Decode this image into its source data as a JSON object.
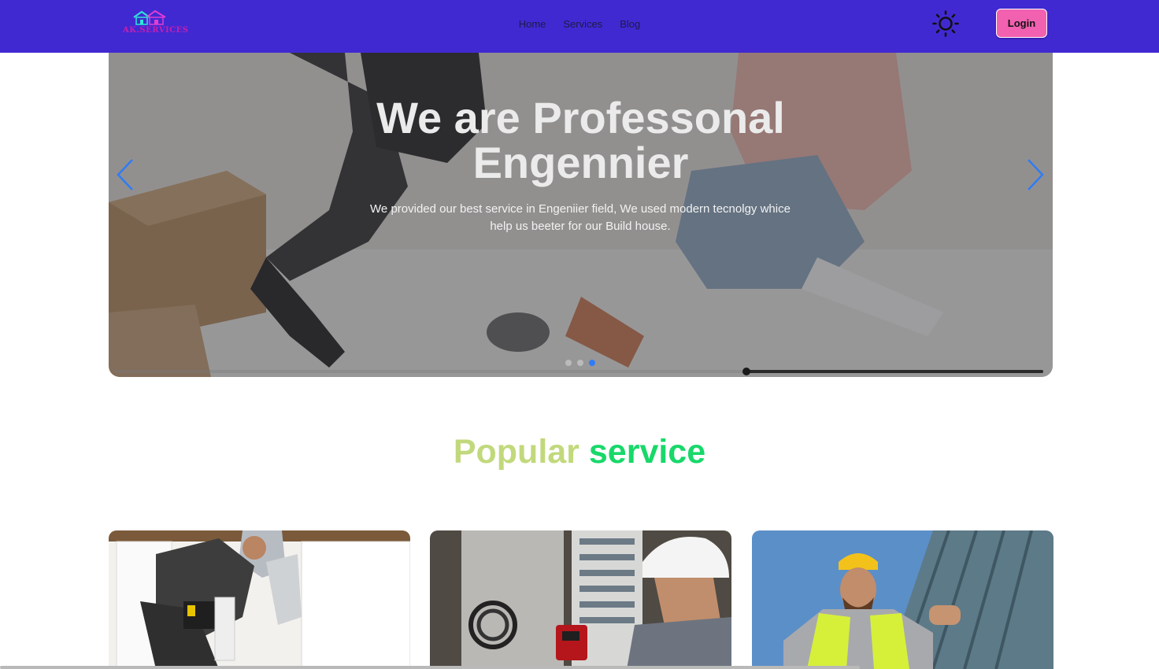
{
  "brand": {
    "logo_text": "AK.SERVICES",
    "primary_color": "#4129d2",
    "accent_color": "#f260b0"
  },
  "nav": {
    "links": [
      {
        "label": "Home"
      },
      {
        "label": "Services"
      },
      {
        "label": "Blog"
      }
    ],
    "theme_icon": "sun-icon",
    "login_label": "Login"
  },
  "hero": {
    "title_line1": "We are Professonal",
    "title_line2": "Engennier",
    "description": "We provided our best service in Engeniier field, We used modern tecnolgy whice help us beeter for our Build house.",
    "slides_count": 3,
    "active_slide": 3,
    "autoplay_progress": 0.68,
    "prev_icon": "chevron-left-icon",
    "next_icon": "chevron-right-icon"
  },
  "services": {
    "title_part1": "Popular",
    "title_part2": "service",
    "title_part1_color": "#c1d97c",
    "title_part2_color": "#18d86a",
    "cards": [
      {
        "image": "plumber-under-sink-photo"
      },
      {
        "image": "electrician-panel-photo"
      },
      {
        "image": "roofer-worker-photo"
      }
    ]
  }
}
